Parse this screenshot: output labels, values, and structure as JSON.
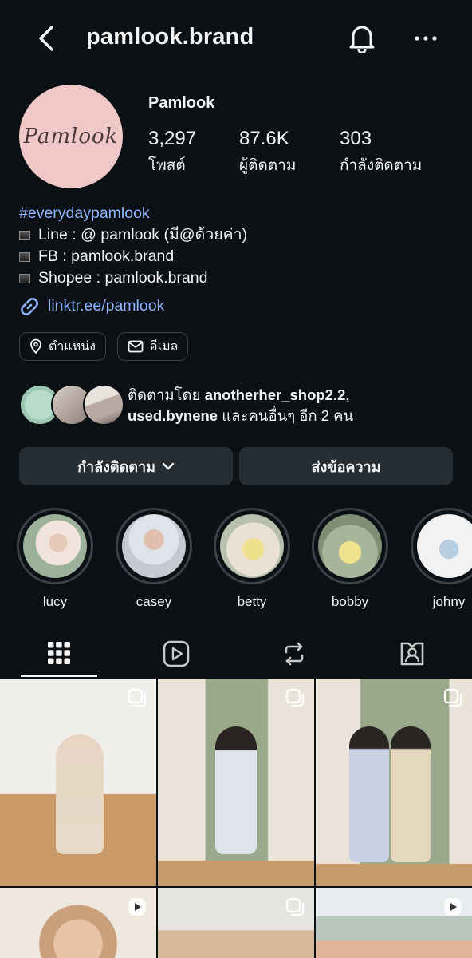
{
  "header": {
    "username": "pamlook.brand",
    "back_icon": "chevron-left-icon",
    "bell_icon": "bell-icon",
    "more_icon": "more-horizontal-icon"
  },
  "profile": {
    "avatar_text": "Pamlook",
    "display_name": "Pamlook",
    "stats": [
      {
        "value": "3,297",
        "label": "โพสต์"
      },
      {
        "value": "87.6K",
        "label": "ผู้ติดตาม"
      },
      {
        "value": "303",
        "label": "กำลังติดตาม"
      }
    ],
    "bio": {
      "hashtag": "#everydaypamlook",
      "lines": [
        "Line : @ pamlook (มี@ด้วยค่า)",
        "FB : pamlook.brand",
        "Shopee : pamlook.brand"
      ],
      "link": "linktr.ee/pamlook"
    },
    "chips": [
      {
        "label": "ตำแหน่ง",
        "icon": "location-pin-icon"
      },
      {
        "label": "อีเมล",
        "icon": "mail-icon"
      }
    ],
    "followed_by": {
      "prefix": "ติดตามโดย ",
      "user1": "anotherher_shop2.2,",
      "user2": "used.bynene",
      "suffix": " และคนอื่นๆ อีก 2 คน"
    },
    "buttons": {
      "following": "กำลังติดตาม",
      "message": "ส่งข้อความ"
    }
  },
  "highlights": [
    {
      "label": "lucy"
    },
    {
      "label": "casey"
    },
    {
      "label": "betty"
    },
    {
      "label": "bobby"
    },
    {
      "label": "johny"
    }
  ],
  "tabs": [
    {
      "name": "grid-icon"
    },
    {
      "name": "reels-icon"
    },
    {
      "name": "repost-icon"
    },
    {
      "name": "tagged-icon"
    }
  ],
  "colors": {
    "background": "#0b1014",
    "link": "#8fb4ff",
    "button": "#262d33",
    "avatar": "#f1c8c8"
  }
}
